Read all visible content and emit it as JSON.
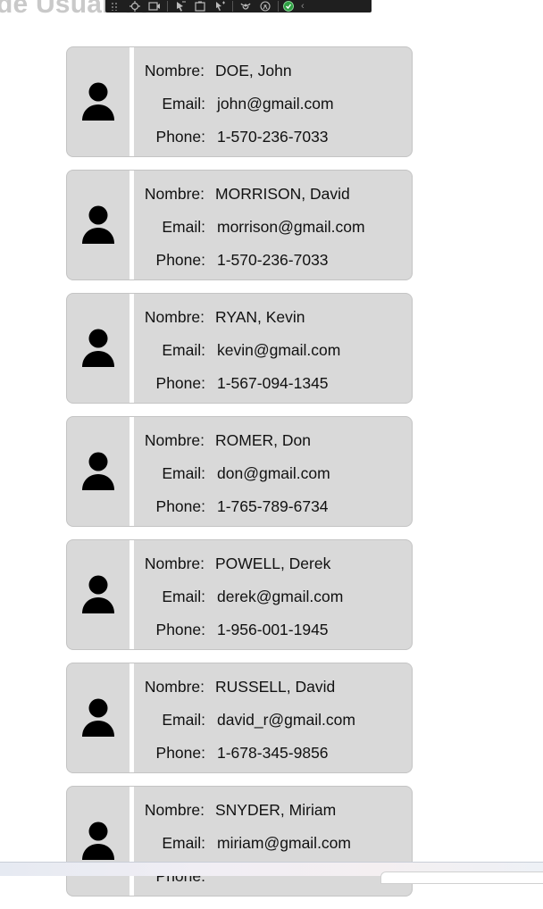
{
  "page": {
    "heading": "de Usuarios"
  },
  "labels": {
    "name": "Nombre:",
    "email": "Email:",
    "phone": "Phone:"
  },
  "users": [
    {
      "name": "DOE, John",
      "email": "john@gmail.com",
      "phone": "1-570-236-7033"
    },
    {
      "name": "MORRISON, David",
      "email": "morrison@gmail.com",
      "phone": "1-570-236-7033"
    },
    {
      "name": "RYAN, Kevin",
      "email": "kevin@gmail.com",
      "phone": "1-567-094-1345"
    },
    {
      "name": "ROMER, Don",
      "email": "don@gmail.com",
      "phone": "1-765-789-6734"
    },
    {
      "name": "POWELL, Derek",
      "email": "derek@gmail.com",
      "phone": "1-956-001-1945"
    },
    {
      "name": "RUSSELL, David",
      "email": "david_r@gmail.com",
      "phone": "1-678-345-9856"
    },
    {
      "name": "SNYDER, Miriam",
      "email": "miriam@gmail.com",
      "phone": ""
    }
  ],
  "devtools_bar": {
    "icons": [
      "inspect-icon",
      "device-icon",
      "select-element-icon",
      "layout-icon",
      "touch-icon",
      "accessibility-icon",
      "a11y-checker-icon",
      "status-ok-icon",
      "collapse-chevron-icon"
    ]
  }
}
